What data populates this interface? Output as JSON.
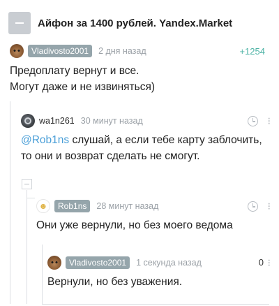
{
  "post": {
    "title": "Айфон за 1400 рублей. Yandex.Market"
  },
  "comments": [
    {
      "author": "Vladivosto2001",
      "time": "2 дня назад",
      "rating": "+1254",
      "text_lines": [
        "Предоплату вернут и все.",
        "Могут даже и не извиняться)"
      ]
    },
    {
      "author": "wa1n261",
      "time": "30 минут назад",
      "mention": "@Rob1ns",
      "text_line1_rest": " слушай, а если тебе карту заблочить,",
      "text_line2": "то они и возврат сделать не смогут."
    },
    {
      "author": "Rob1ns",
      "time": "28 минут назад",
      "text": "Они уже вернули, но без моего ведома"
    },
    {
      "author": "Vladivosto2001",
      "time": "1 секунда назад",
      "rating": "0",
      "text": "Вернули, но без уважения."
    }
  ],
  "icons": {
    "collapse": "minus-square-icon",
    "history": "clock-icon",
    "more": "more-dots-icon"
  },
  "colors": {
    "accent": "#4db3a5",
    "mention": "#4a9fd8",
    "badge": "#95a5ab",
    "muted": "#9aa0a6"
  }
}
